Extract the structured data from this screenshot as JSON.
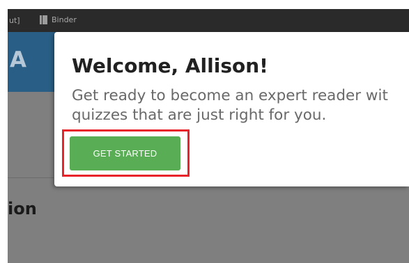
{
  "top_bar": {
    "left_fragment": "ut]",
    "binder_label": "Binder",
    "binder_icon": "binder-icon"
  },
  "background": {
    "header_letter": "A",
    "heading_fragment": "ion",
    "colors": {
      "overlay": "#7f7f7f",
      "header_blue": "#295f86",
      "top_bar": "#2a2a2a"
    }
  },
  "modal": {
    "title": "Welcome, Allison!",
    "body_lines": [
      "Get ready to become an expert reader wit",
      "quizzes that are just right for you."
    ],
    "button_label": "GET STARTED",
    "button_color": "#58ad55",
    "highlight_color": "#e8232a"
  }
}
